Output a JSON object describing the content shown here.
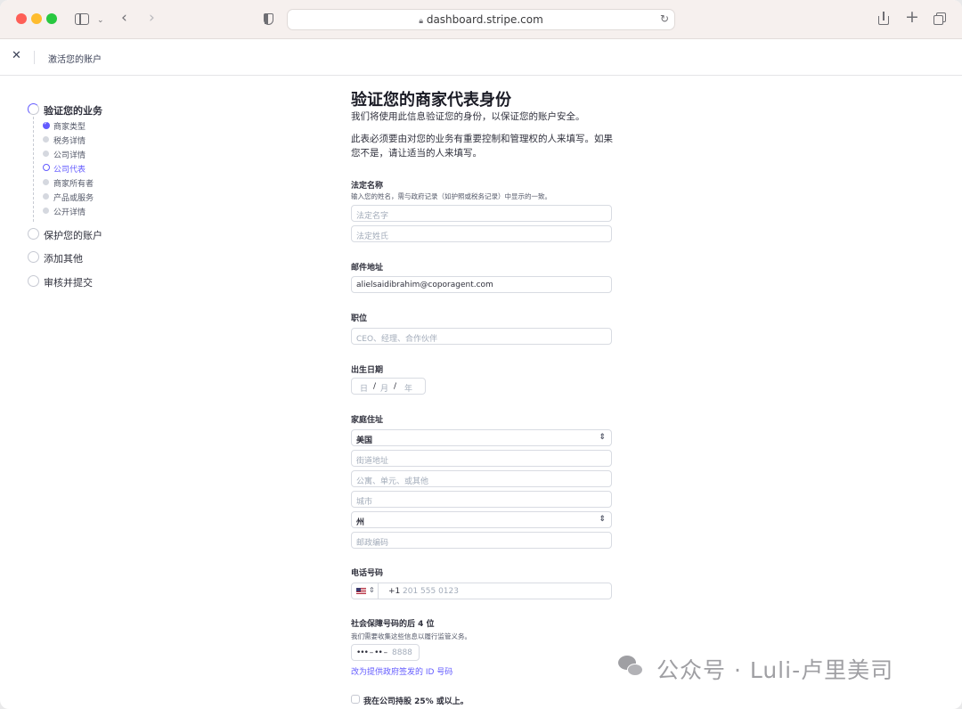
{
  "browser": {
    "url": "dashboard.stripe.com"
  },
  "header": {
    "title": "激活您的账户"
  },
  "sidebar": {
    "steps": [
      {
        "label": "验证您的业务",
        "state": "in-progress"
      },
      {
        "label": "保护您的账户",
        "state": "pending"
      },
      {
        "label": "添加其他",
        "state": "pending"
      },
      {
        "label": "审核并提交",
        "state": "pending"
      }
    ],
    "substeps": [
      {
        "label": "商家类型",
        "state": "done"
      },
      {
        "label": "税务详情",
        "state": "pending"
      },
      {
        "label": "公司详情",
        "state": "pending"
      },
      {
        "label": "公司代表",
        "state": "current"
      },
      {
        "label": "商家所有者",
        "state": "pending"
      },
      {
        "label": "产品或服务",
        "state": "pending"
      },
      {
        "label": "公开详情",
        "state": "pending"
      }
    ]
  },
  "form": {
    "title": "验证您的商家代表身份",
    "intro": "我们将使用此信息验证您的身份，以保证您的账户安全。",
    "notice_line1": "此表必须要由对您的业务有重要控制和管理权的人来填写。如果",
    "notice_line2": "您不是，请让适当的人来填写。",
    "legal_name": {
      "label": "法定名称",
      "hint": "输入您的姓名，需与政府记录（如护照或税务记录）中显示的一致。",
      "first_placeholder": "法定名字",
      "last_placeholder": "法定姓氏"
    },
    "email": {
      "label": "邮件地址",
      "value": "alielsaidibrahim@coporagent.com"
    },
    "position": {
      "label": "职位",
      "placeholder": "CEO、经理、合作伙伴"
    },
    "dob": {
      "label": "出生日期",
      "day": "日",
      "month": "月",
      "year": "年",
      "sep": "/"
    },
    "address": {
      "label": "家庭住址",
      "country": "美国",
      "street_placeholder": "街道地址",
      "unit_placeholder": "公寓、单元、或其他",
      "city_placeholder": "城市",
      "state": "州",
      "zip_placeholder": "邮政编码"
    },
    "phone": {
      "label": "电话号码",
      "country_code": "+1",
      "placeholder": "201 555 0123"
    },
    "ssn": {
      "label": "社会保障号码的后 4 位",
      "hint": "我们需要收集这些信息以履行监管义务。",
      "mask": "••• – •• –",
      "placeholder": "8888",
      "alt_link": "改为提供政府签发的 ID 号码"
    },
    "ownership_checkbox": "我在公司持股 25% 或以上。"
  },
  "watermark": "公众号 · Luli-卢里美司",
  "colors": {
    "accent": "#635bff",
    "text": "#30313d"
  }
}
